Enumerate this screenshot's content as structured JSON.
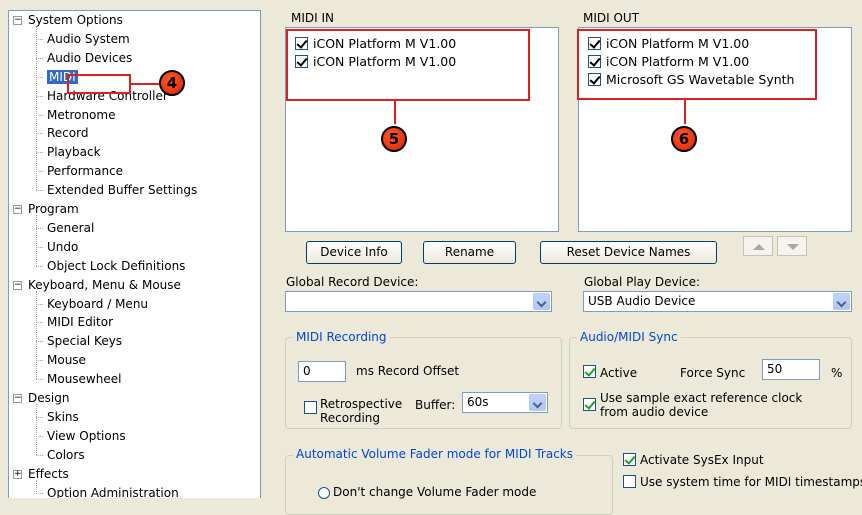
{
  "tree": {
    "items": [
      {
        "label": "System Options",
        "expander": "−"
      },
      {
        "label": "Audio System"
      },
      {
        "label": "Audio Devices"
      },
      {
        "label": "MIDI"
      },
      {
        "label": "Hardware Controller"
      },
      {
        "label": "Metronome"
      },
      {
        "label": "Record"
      },
      {
        "label": "Playback"
      },
      {
        "label": "Performance"
      },
      {
        "label": "Extended Buffer Settings"
      },
      {
        "label": "Program",
        "expander": "−"
      },
      {
        "label": "General"
      },
      {
        "label": "Undo"
      },
      {
        "label": "Object Lock Definitions"
      },
      {
        "label": "Keyboard, Menu & Mouse",
        "expander": "−"
      },
      {
        "label": "Keyboard / Menu"
      },
      {
        "label": "MIDI Editor"
      },
      {
        "label": "Special Keys"
      },
      {
        "label": "Mouse"
      },
      {
        "label": "Mousewheel"
      },
      {
        "label": "Design",
        "expander": "−"
      },
      {
        "label": "Skins"
      },
      {
        "label": "View Options"
      },
      {
        "label": "Colors"
      },
      {
        "label": "Effects",
        "expander": "+"
      },
      {
        "label": "Option Administration"
      }
    ]
  },
  "midi_in": {
    "title": "MIDI IN",
    "devices": [
      "iCON Platform M V1.00",
      "iCON Platform M V1.00"
    ]
  },
  "midi_out": {
    "title": "MIDI OUT",
    "devices": [
      "iCON Platform M V1.00",
      "iCON Platform M V1.00",
      "Microsoft GS Wavetable Synth"
    ]
  },
  "callouts": {
    "c4": "4",
    "c5": "5",
    "c6": "6"
  },
  "buttons": {
    "device_info": "Device Info",
    "rename": "Rename",
    "reset_device_names": "Reset Device Names",
    "move_up_icon": "triangle-up-icon",
    "move_down_icon": "triangle-down-icon"
  },
  "global_record": {
    "label": "Global Record Device:",
    "value": ""
  },
  "global_play": {
    "label": "Global Play Device:",
    "value": "USB Audio Device"
  },
  "midi_recording": {
    "title": "MIDI Recording",
    "offset_value": "0",
    "offset_label": "ms  Record Offset",
    "retro_label_1": "Retrospective",
    "retro_label_2": "Recording",
    "buffer_label": "Buffer:",
    "buffer_value": "60s"
  },
  "sync": {
    "title": "Audio/MIDI Sync",
    "active_label": "Active",
    "force_sync_label": "Force Sync",
    "force_sync_value": "50",
    "percent": "%",
    "sample_exact_1": "Use sample exact reference clock",
    "sample_exact_2": "from audio device"
  },
  "fader": {
    "title": "Automatic Volume Fader mode for MIDI Tracks",
    "option_dont_change": "Don't change Volume Fader mode"
  },
  "sysex": {
    "activate_label": "Activate SysEx Input",
    "system_time_label": "Use system time for MIDI timestamps"
  },
  "colors": {
    "accent": "#e02020",
    "selection": "#316ac5",
    "group_title": "#0046d5"
  }
}
